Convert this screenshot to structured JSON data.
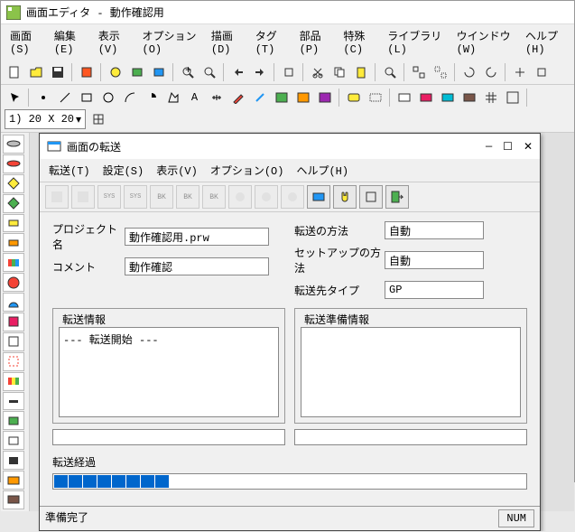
{
  "app": {
    "title": "画面エディタ - 動作確認用",
    "menus": [
      "画面(S)",
      "編集(E)",
      "表示(V)",
      "オプション(O)",
      "描画(D)",
      "タグ(T)",
      "部品(P)",
      "特殊(C)",
      "ライブラリ(L)",
      "ウインドウ(W)",
      "ヘルプ(H)"
    ],
    "zoom_combo": "1) 20 X 20"
  },
  "dialog": {
    "title": "画面の転送",
    "menus": [
      "転送(T)",
      "設定(S)",
      "表示(V)",
      "オプション(O)",
      "ヘルプ(H)"
    ],
    "project_label": "プロジェクト名",
    "project_value": "動作確認用.prw",
    "comment_label": "コメント",
    "comment_value": "動作確認",
    "method_label": "転送の方法",
    "method_value": "自動",
    "setup_label": "セットアップの方法",
    "setup_value": "自動",
    "target_label": "転送先タイプ",
    "target_value": "GP",
    "info_title": "転送情報",
    "info_text": "--- 転送開始 ---",
    "prep_title": "転送準備情報",
    "prep_text": "",
    "progress_label": "転送経過",
    "status": "準備完了",
    "num": "NUM"
  }
}
